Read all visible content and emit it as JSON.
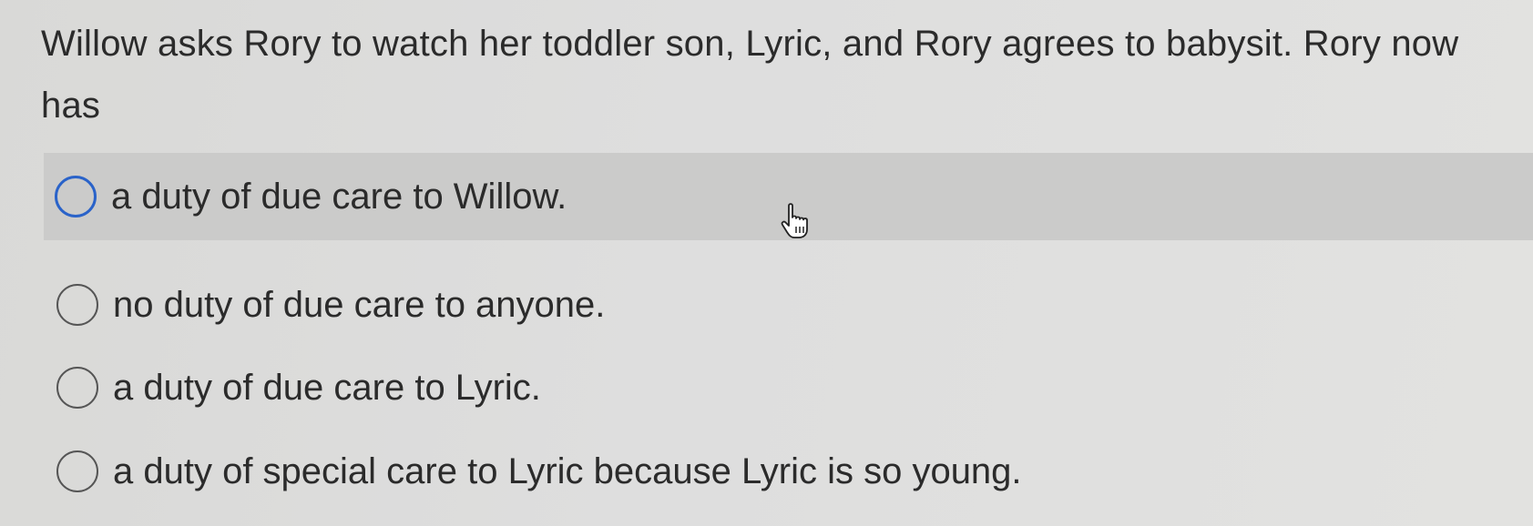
{
  "question": {
    "text": "Willow asks Rory to watch her toddler son, Lyric, and Rory agrees to babysit. Rory now has"
  },
  "options": [
    {
      "label": "a duty of due care to Willow."
    },
    {
      "label": "no duty of due care to anyone."
    },
    {
      "label": "a duty of due care to Lyric."
    },
    {
      "label": "a duty of special care to Lyric because Lyric is so young."
    }
  ],
  "state": {
    "hovered_option_index": 0,
    "selected_option_index": null
  },
  "colors": {
    "highlight_background": "#cbcbca",
    "focus_ring": "#2a63c9",
    "text": "#2b2b2b"
  },
  "icons": {
    "cursor": "hand-pointer-icon"
  }
}
